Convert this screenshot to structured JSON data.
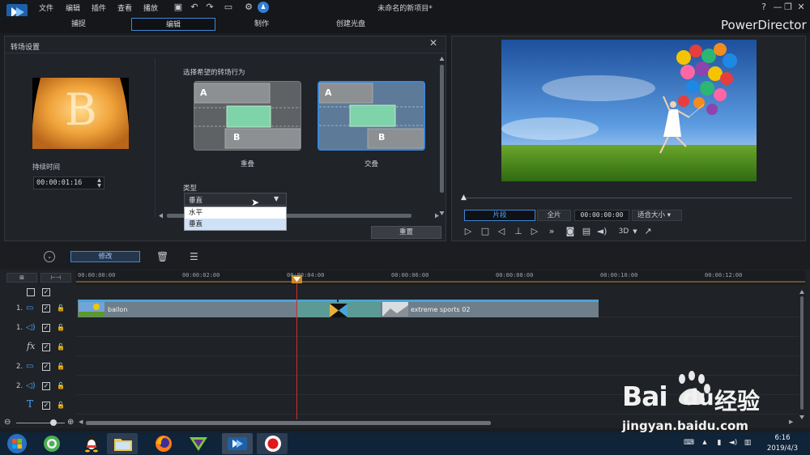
{
  "menu": {
    "items": [
      "文件",
      "编辑",
      "插件",
      "查看",
      "播放"
    ],
    "window_title": "未命名的新项目*"
  },
  "window_controls": {
    "help": "?",
    "minimize": "—",
    "restore": "❐",
    "close": "✕"
  },
  "mode_tabs": [
    "捕捉",
    "编辑",
    "制作",
    "创建光盘"
  ],
  "brand": "PowerDirector",
  "transition_panel": {
    "title": "转场设置",
    "duration_label": "持续时间",
    "duration_value": "00:00:01:16",
    "choose_label": "选择希望的转场行为",
    "options": [
      {
        "label": "重叠",
        "a": "A",
        "b": "B",
        "selected": false
      },
      {
        "label": "交叠",
        "a": "A",
        "b": "B",
        "selected": true
      }
    ],
    "type_label": "类型",
    "type_value": "垂直",
    "type_options": [
      "水平",
      "垂直"
    ],
    "reset_label": "重置",
    "preview_letter": "B"
  },
  "preview": {
    "segment_label": "片段",
    "full_label": "全片",
    "timecode": "00:00:00:00",
    "fit_label": "适合大小",
    "threed_label": "3D"
  },
  "edit_toolbar": {
    "modify_label": "修改"
  },
  "timeline": {
    "ticks": [
      "00:00:00:00",
      "00:00:02:00",
      "00:00:04:00",
      "00:00:06:00",
      "00:00:08:00",
      "00:00:10:00",
      "00:00:12:00"
    ],
    "tracks": [
      {
        "num": "1.",
        "type": "video"
      },
      {
        "num": "1.",
        "type": "audio"
      },
      {
        "num": "",
        "type": "fx"
      },
      {
        "num": "2.",
        "type": "video"
      },
      {
        "num": "2.",
        "type": "audio"
      },
      {
        "num": "",
        "type": "title"
      }
    ],
    "clip_a": "ballon",
    "clip_b": "extreme sports 02",
    "fx_glyph": "fx",
    "title_glyph": "T"
  },
  "taskbar": {
    "time": "6:16",
    "date": "2019/4/3"
  },
  "watermark": {
    "url": "jingyan.baidu.com",
    "logo_text": "Bai",
    "logo_text2": "du",
    "logo_cn": "经验"
  },
  "colors": {
    "accent": "#3d88d6",
    "playhead": "#d22c2c",
    "clip": "#6e7e8a",
    "overlap": "#5c9a95"
  }
}
